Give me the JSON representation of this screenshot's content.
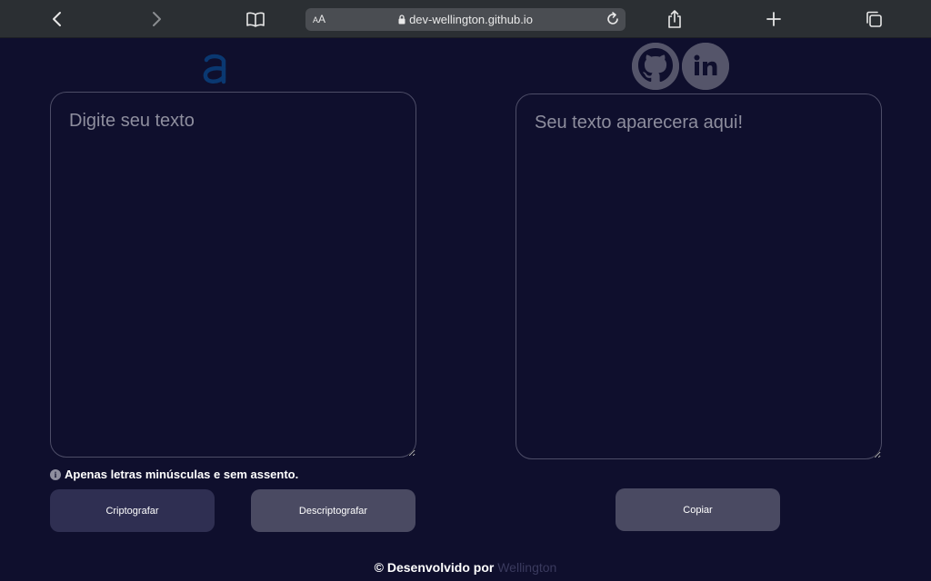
{
  "browser": {
    "url": "dev-wellington.github.io",
    "aa_small": "A",
    "aa_large": "A"
  },
  "main": {
    "input_placeholder": "Digite seu texto",
    "output_placeholder": "Seu texto aparecera aqui!",
    "hint": "Apenas letras minúsculas e sem assento.",
    "hint_icon": "i",
    "encrypt_label": "Criptografar",
    "decrypt_label": "Descriptografar",
    "copy_label": "Copiar"
  },
  "footer": {
    "prefix": "© Desenvolvido por",
    "author": "Wellington"
  },
  "colors": {
    "background": "#0f0f2d",
    "accent": "#0a3871",
    "button_primary": "#2f2f52",
    "button_secondary": "#4a4a62"
  },
  "icons": [
    "back-icon",
    "forward-icon",
    "bookmarks-icon",
    "lock-icon",
    "reload-icon",
    "share-icon",
    "plus-icon",
    "tabs-icon",
    "logo-icon",
    "github-icon",
    "linkedin-icon",
    "info-icon"
  ]
}
